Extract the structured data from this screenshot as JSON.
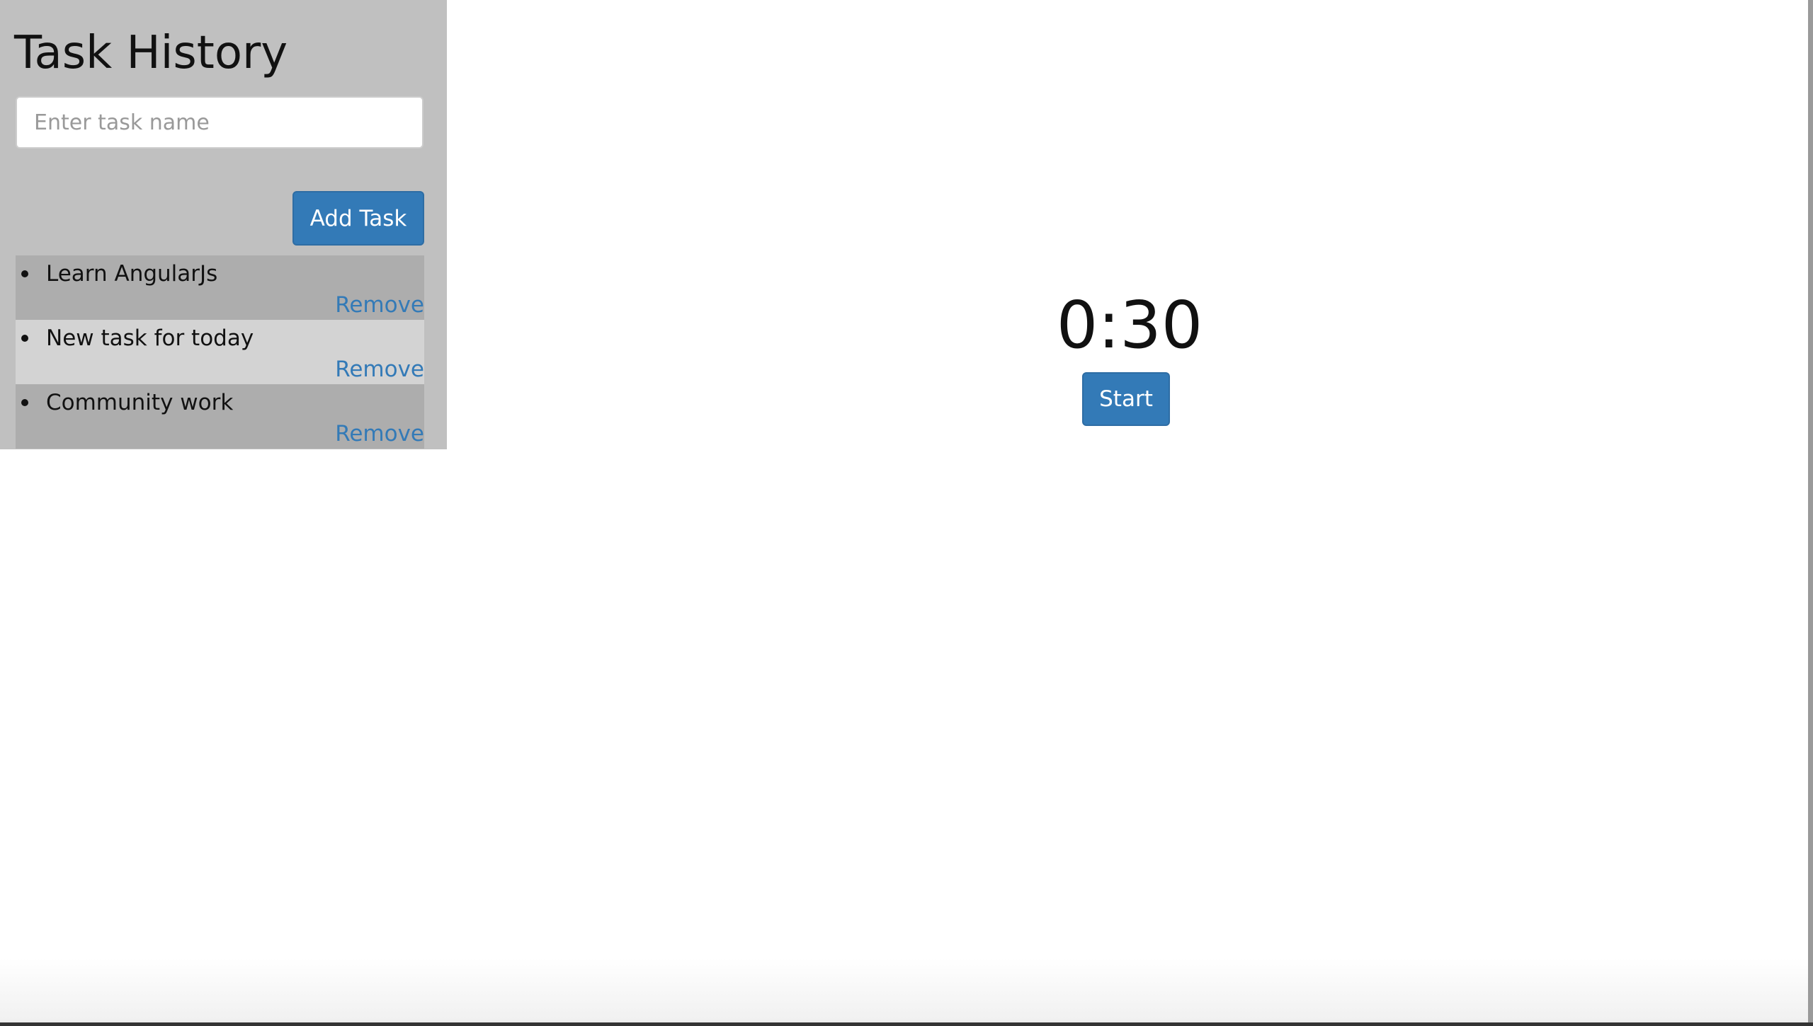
{
  "sidebar": {
    "title": "Task History",
    "input": {
      "placeholder": "Enter task name",
      "value": ""
    },
    "add_button_label": "Add Task",
    "tasks": [
      {
        "name": "Learn AngularJs",
        "remove_label": "Remove"
      },
      {
        "name": "New task for today",
        "remove_label": "Remove"
      },
      {
        "name": "Community work",
        "remove_label": "Remove"
      }
    ]
  },
  "main": {
    "timer": "0:30",
    "start_button_label": "Start"
  },
  "colors": {
    "sidebar_background": "#c0c0c0",
    "row_dark": "#adadad",
    "row_light": "#d3d3d3",
    "primary_button": "#337ab7",
    "link": "#337ab7"
  }
}
